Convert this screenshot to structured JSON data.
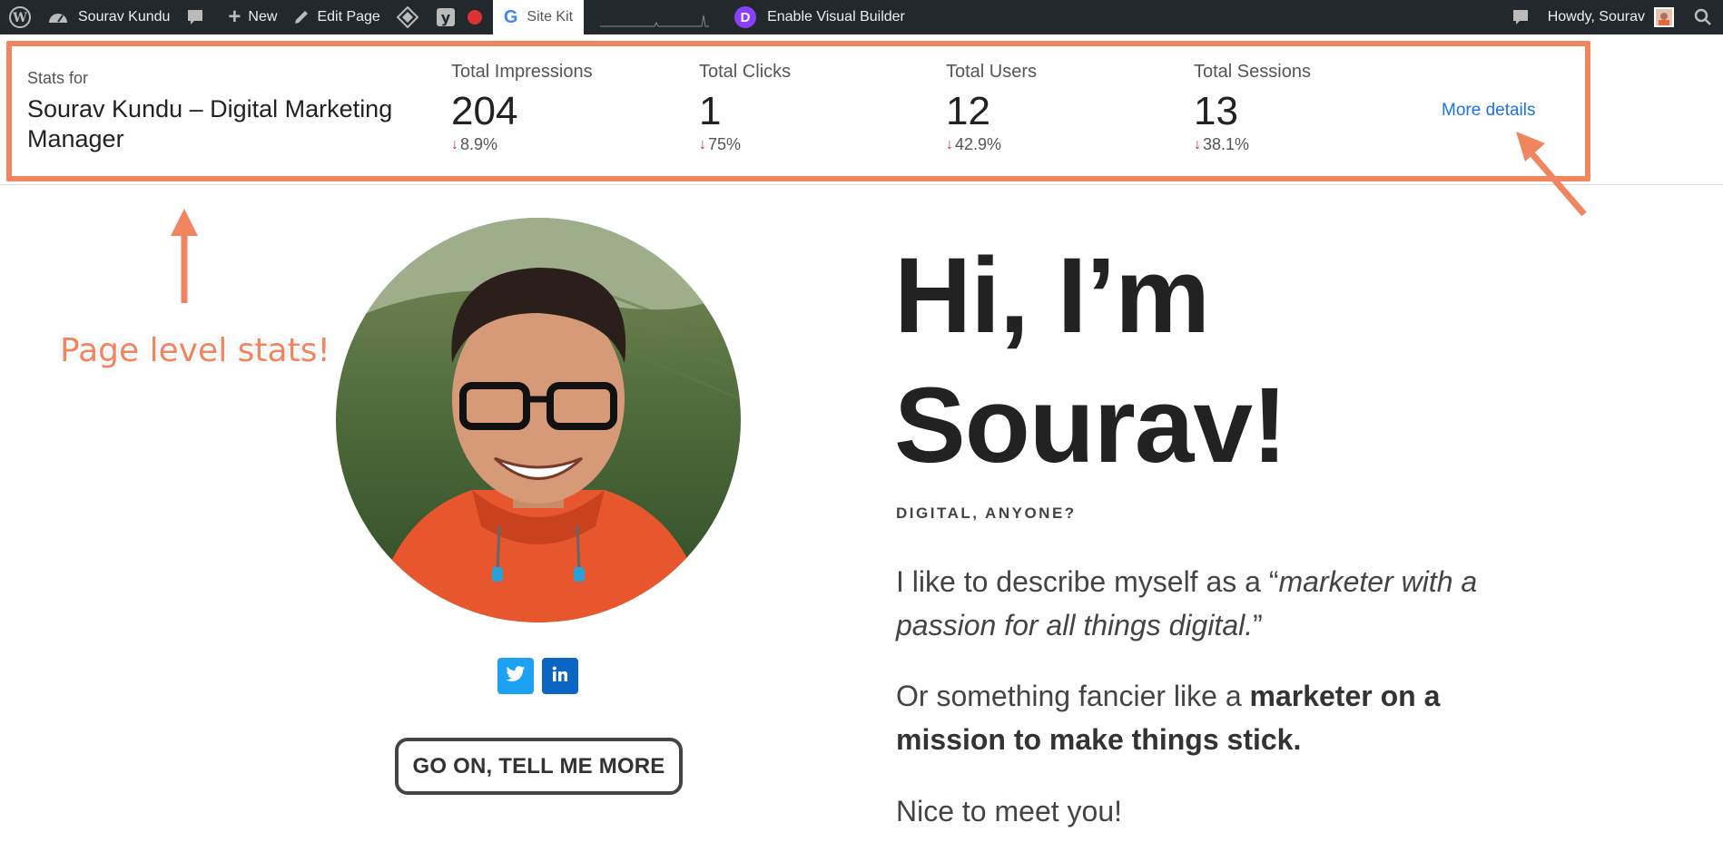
{
  "admin_bar": {
    "site_name": "Sourav Kundu",
    "new_label": "New",
    "edit_label": "Edit Page",
    "sitekit_label": "Site Kit",
    "divi_badge": "D",
    "visual_builder_label": "Enable Visual Builder",
    "howdy_label": "Howdy, Sourav"
  },
  "stats": {
    "stats_for_label": "Stats for",
    "page_title": "Sourav Kundu – Digital Marketing Manager",
    "metrics": [
      {
        "label": "Total Impressions",
        "value": "204",
        "change": "8.9%",
        "direction": "down"
      },
      {
        "label": "Total Clicks",
        "value": "1",
        "change": "75%",
        "direction": "down"
      },
      {
        "label": "Total Users",
        "value": "12",
        "change": "42.9%",
        "direction": "down"
      },
      {
        "label": "Total Sessions",
        "value": "13",
        "change": "38.1%",
        "direction": "down"
      }
    ],
    "more_details_label": "More details"
  },
  "annotation": {
    "text": "Page level stats!",
    "color": "#f0855f"
  },
  "hero": {
    "title_line1": "Hi, I’m",
    "title_line2": "Sourav!",
    "eyebrow": "DIGITAL, ANYONE?",
    "para1_pre": "I like to describe myself as a “",
    "para1_em": "marketer with a passion for all things digital.",
    "para1_post": "”",
    "para2_pre": "Or something fancier like a ",
    "para2_bold": "marketer on a mission to make things stick.",
    "para3": "Nice to meet you!",
    "cta_label": "GO ON, TELL ME MORE"
  },
  "colors": {
    "admin_bar_bg": "#23282d",
    "accent_link": "#1a73e8",
    "down_arrow": "#c92c2c",
    "twitter": "#1da1f2",
    "linkedin": "#0a66c2"
  }
}
